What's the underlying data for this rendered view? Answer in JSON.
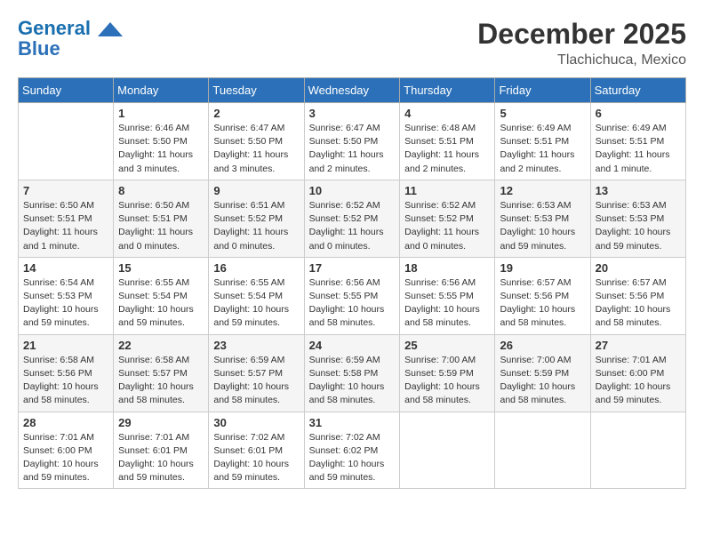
{
  "header": {
    "logo_line1": "General",
    "logo_line2": "Blue",
    "month": "December 2025",
    "location": "Tlachichuca, Mexico"
  },
  "days_of_week": [
    "Sunday",
    "Monday",
    "Tuesday",
    "Wednesday",
    "Thursday",
    "Friday",
    "Saturday"
  ],
  "weeks": [
    [
      {
        "day": "",
        "info": ""
      },
      {
        "day": "1",
        "info": "Sunrise: 6:46 AM\nSunset: 5:50 PM\nDaylight: 11 hours and 3 minutes."
      },
      {
        "day": "2",
        "info": "Sunrise: 6:47 AM\nSunset: 5:50 PM\nDaylight: 11 hours and 3 minutes."
      },
      {
        "day": "3",
        "info": "Sunrise: 6:47 AM\nSunset: 5:50 PM\nDaylight: 11 hours and 2 minutes."
      },
      {
        "day": "4",
        "info": "Sunrise: 6:48 AM\nSunset: 5:51 PM\nDaylight: 11 hours and 2 minutes."
      },
      {
        "day": "5",
        "info": "Sunrise: 6:49 AM\nSunset: 5:51 PM\nDaylight: 11 hours and 2 minutes."
      },
      {
        "day": "6",
        "info": "Sunrise: 6:49 AM\nSunset: 5:51 PM\nDaylight: 11 hours and 1 minute."
      }
    ],
    [
      {
        "day": "7",
        "info": "Sunrise: 6:50 AM\nSunset: 5:51 PM\nDaylight: 11 hours and 1 minute."
      },
      {
        "day": "8",
        "info": "Sunrise: 6:50 AM\nSunset: 5:51 PM\nDaylight: 11 hours and 0 minutes."
      },
      {
        "day": "9",
        "info": "Sunrise: 6:51 AM\nSunset: 5:52 PM\nDaylight: 11 hours and 0 minutes."
      },
      {
        "day": "10",
        "info": "Sunrise: 6:52 AM\nSunset: 5:52 PM\nDaylight: 11 hours and 0 minutes."
      },
      {
        "day": "11",
        "info": "Sunrise: 6:52 AM\nSunset: 5:52 PM\nDaylight: 11 hours and 0 minutes."
      },
      {
        "day": "12",
        "info": "Sunrise: 6:53 AM\nSunset: 5:53 PM\nDaylight: 10 hours and 59 minutes."
      },
      {
        "day": "13",
        "info": "Sunrise: 6:53 AM\nSunset: 5:53 PM\nDaylight: 10 hours and 59 minutes."
      }
    ],
    [
      {
        "day": "14",
        "info": "Sunrise: 6:54 AM\nSunset: 5:53 PM\nDaylight: 10 hours and 59 minutes."
      },
      {
        "day": "15",
        "info": "Sunrise: 6:55 AM\nSunset: 5:54 PM\nDaylight: 10 hours and 59 minutes."
      },
      {
        "day": "16",
        "info": "Sunrise: 6:55 AM\nSunset: 5:54 PM\nDaylight: 10 hours and 59 minutes."
      },
      {
        "day": "17",
        "info": "Sunrise: 6:56 AM\nSunset: 5:55 PM\nDaylight: 10 hours and 58 minutes."
      },
      {
        "day": "18",
        "info": "Sunrise: 6:56 AM\nSunset: 5:55 PM\nDaylight: 10 hours and 58 minutes."
      },
      {
        "day": "19",
        "info": "Sunrise: 6:57 AM\nSunset: 5:56 PM\nDaylight: 10 hours and 58 minutes."
      },
      {
        "day": "20",
        "info": "Sunrise: 6:57 AM\nSunset: 5:56 PM\nDaylight: 10 hours and 58 minutes."
      }
    ],
    [
      {
        "day": "21",
        "info": "Sunrise: 6:58 AM\nSunset: 5:56 PM\nDaylight: 10 hours and 58 minutes."
      },
      {
        "day": "22",
        "info": "Sunrise: 6:58 AM\nSunset: 5:57 PM\nDaylight: 10 hours and 58 minutes."
      },
      {
        "day": "23",
        "info": "Sunrise: 6:59 AM\nSunset: 5:57 PM\nDaylight: 10 hours and 58 minutes."
      },
      {
        "day": "24",
        "info": "Sunrise: 6:59 AM\nSunset: 5:58 PM\nDaylight: 10 hours and 58 minutes."
      },
      {
        "day": "25",
        "info": "Sunrise: 7:00 AM\nSunset: 5:59 PM\nDaylight: 10 hours and 58 minutes."
      },
      {
        "day": "26",
        "info": "Sunrise: 7:00 AM\nSunset: 5:59 PM\nDaylight: 10 hours and 58 minutes."
      },
      {
        "day": "27",
        "info": "Sunrise: 7:01 AM\nSunset: 6:00 PM\nDaylight: 10 hours and 59 minutes."
      }
    ],
    [
      {
        "day": "28",
        "info": "Sunrise: 7:01 AM\nSunset: 6:00 PM\nDaylight: 10 hours and 59 minutes."
      },
      {
        "day": "29",
        "info": "Sunrise: 7:01 AM\nSunset: 6:01 PM\nDaylight: 10 hours and 59 minutes."
      },
      {
        "day": "30",
        "info": "Sunrise: 7:02 AM\nSunset: 6:01 PM\nDaylight: 10 hours and 59 minutes."
      },
      {
        "day": "31",
        "info": "Sunrise: 7:02 AM\nSunset: 6:02 PM\nDaylight: 10 hours and 59 minutes."
      },
      {
        "day": "",
        "info": ""
      },
      {
        "day": "",
        "info": ""
      },
      {
        "day": "",
        "info": ""
      }
    ]
  ]
}
